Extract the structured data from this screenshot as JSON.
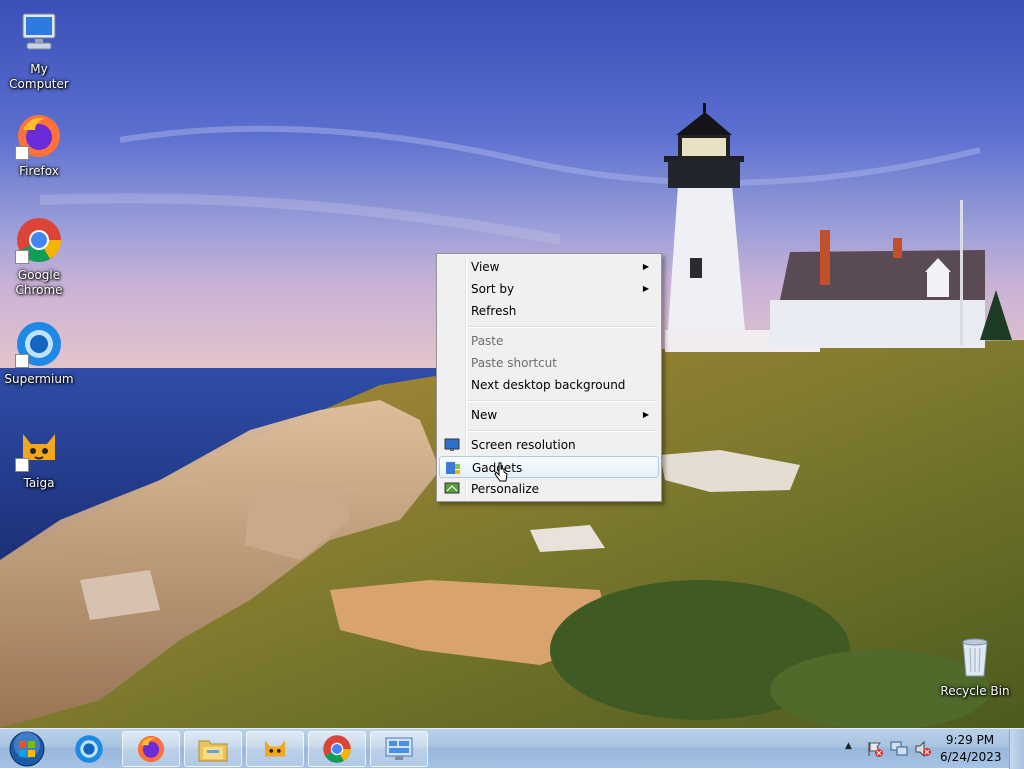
{
  "desktop_icons": [
    {
      "label": "My Computer",
      "icon": "computer-icon"
    },
    {
      "label": "Firefox",
      "icon": "firefox-icon"
    },
    {
      "label": "Google Chrome",
      "icon": "chrome-icon"
    },
    {
      "label": "Supermium",
      "icon": "supermium-icon"
    },
    {
      "label": "Taiga",
      "icon": "taiga-icon"
    }
  ],
  "recycle_bin": {
    "label": "Recycle Bin",
    "icon": "recycle-bin-icon"
  },
  "context_menu": {
    "items": [
      {
        "label": "View",
        "submenu": true,
        "enabled": true
      },
      {
        "label": "Sort by",
        "submenu": true,
        "enabled": true
      },
      {
        "label": "Refresh",
        "enabled": true
      },
      {
        "label": "Paste",
        "enabled": false
      },
      {
        "label": "Paste shortcut",
        "enabled": false
      },
      {
        "label": "Next desktop background",
        "enabled": true
      },
      {
        "label": "New",
        "submenu": true,
        "enabled": true
      },
      {
        "label": "Screen resolution",
        "icon": "screen-resolution-icon",
        "enabled": true
      },
      {
        "label": "Gadgets",
        "icon": "gadgets-icon",
        "enabled": true,
        "hovered": true
      },
      {
        "label": "Personalize",
        "icon": "personalize-icon",
        "enabled": true
      }
    ]
  },
  "taskbar": {
    "start": "start-orb-icon",
    "apps": [
      "supermium-icon",
      "firefox-icon",
      "file-explorer-icon",
      "taiga-icon",
      "chrome-icon",
      "remote-desktop-icon"
    ],
    "tray_icons": [
      "show-hidden-icons-chevron",
      "action-center-flag-icon",
      "network-icon",
      "volume-muted-icon"
    ],
    "clock": {
      "time": "9:29 PM",
      "date": "6/24/2023"
    }
  },
  "colors": {
    "menu_bg": "#f0f0f0",
    "hover_border": "#aeccec",
    "taskbar": "#a8c3e1"
  }
}
